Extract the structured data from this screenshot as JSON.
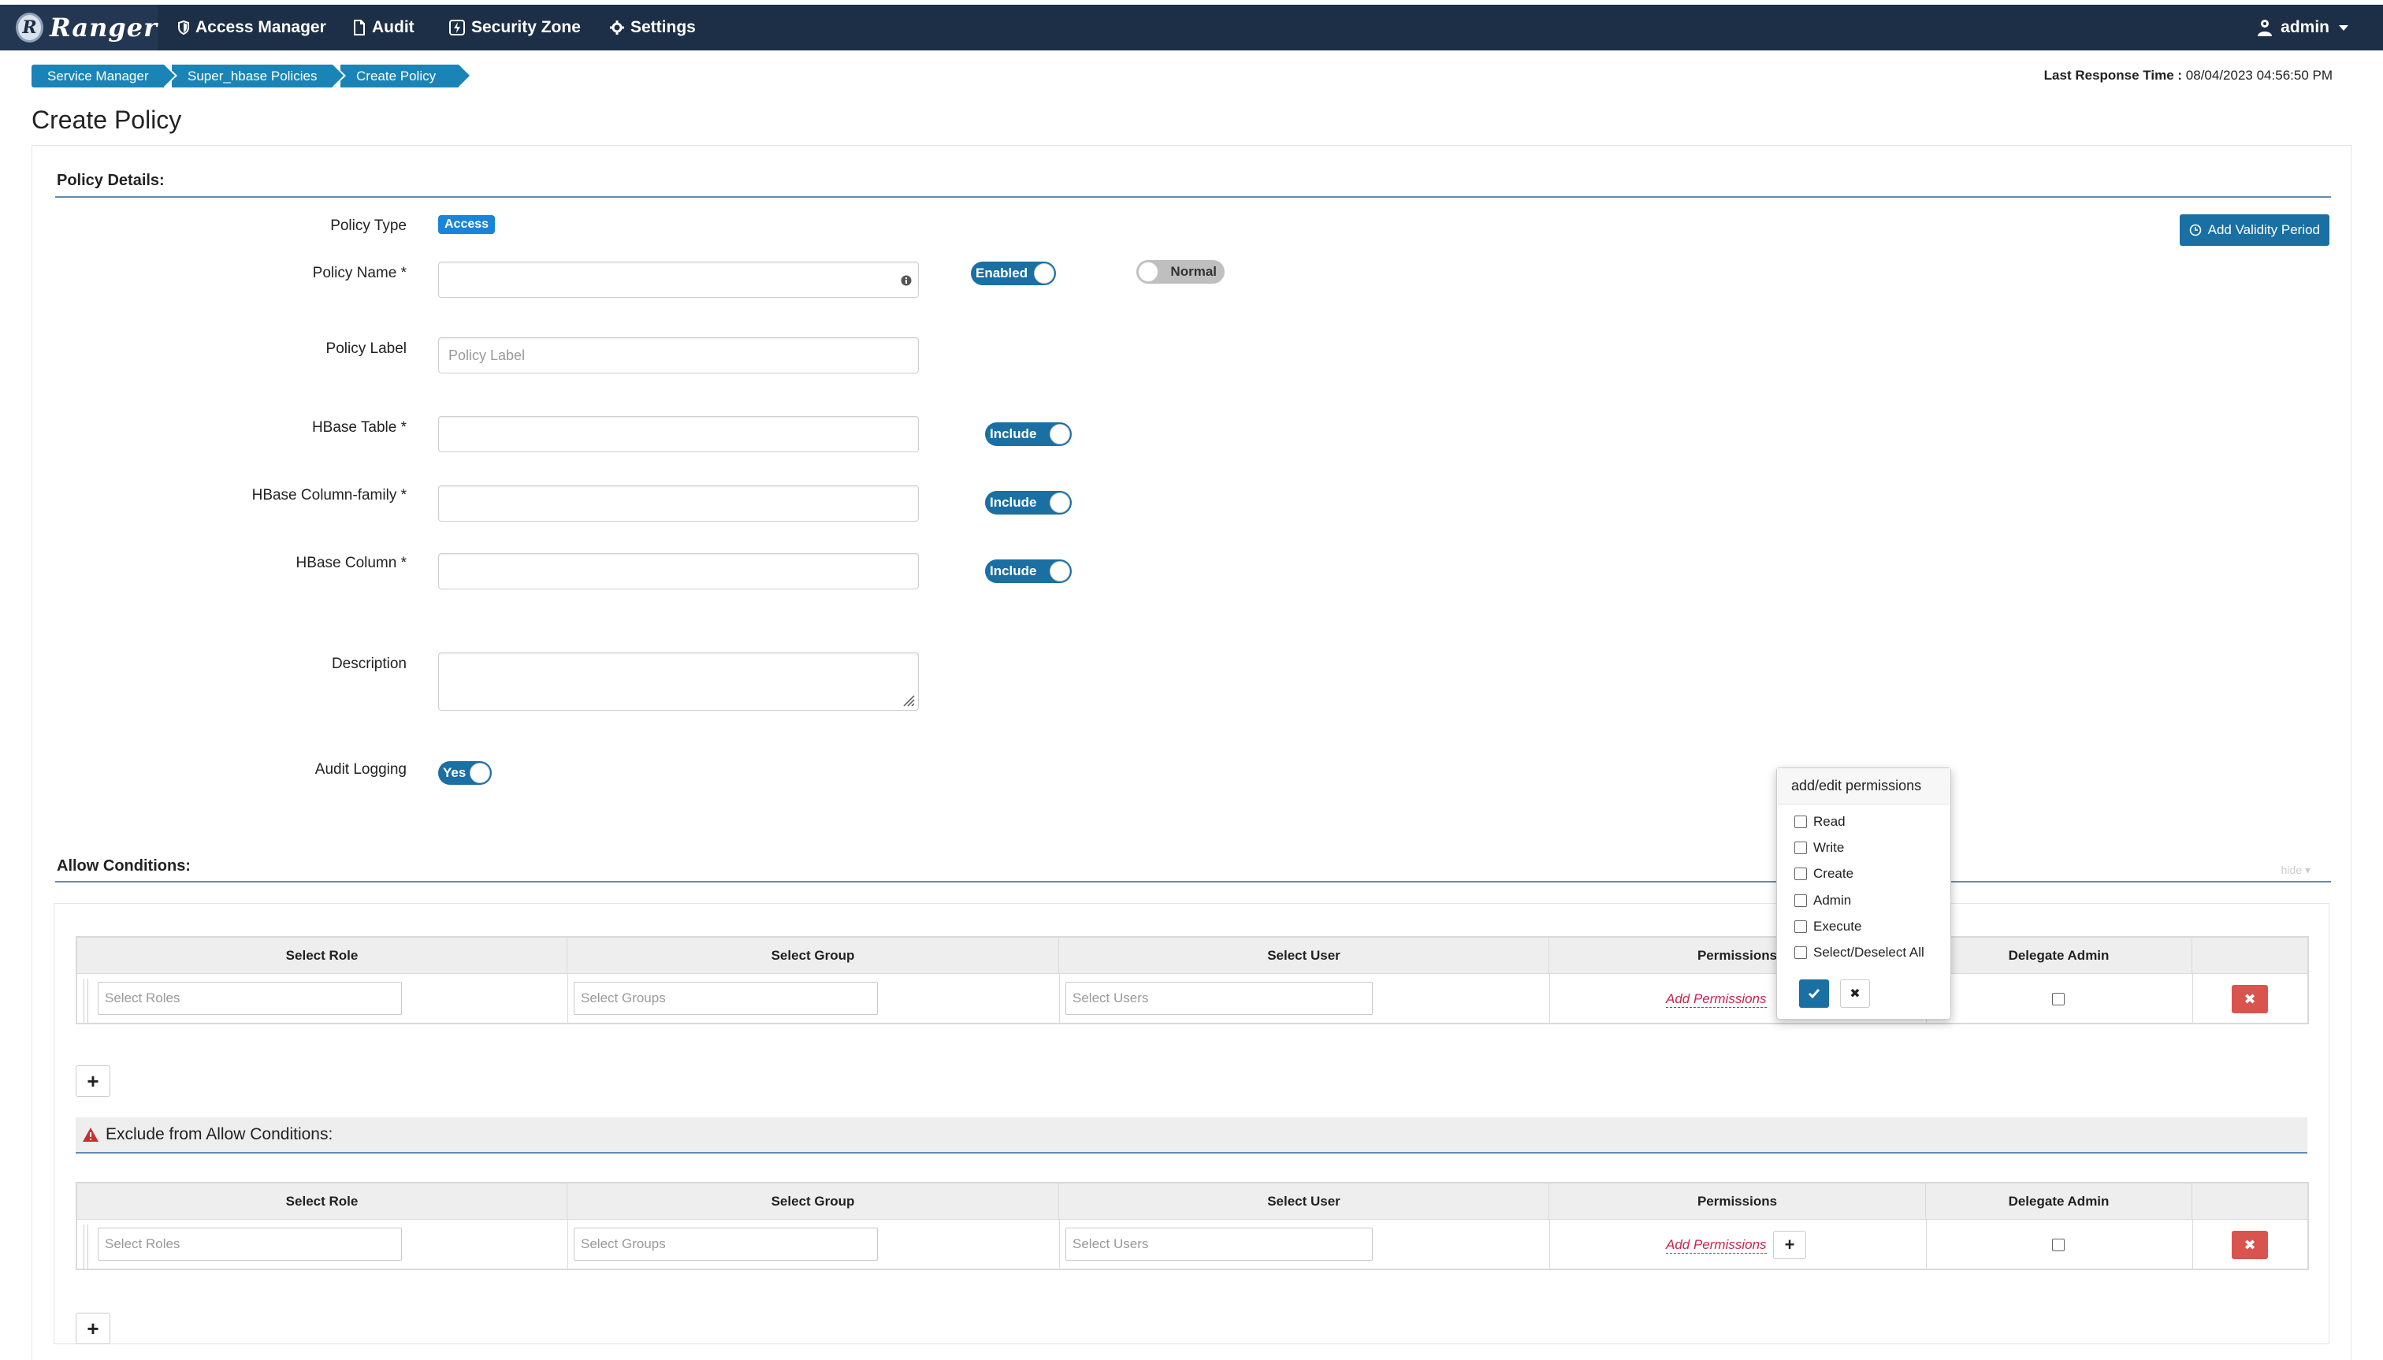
{
  "nav": {
    "brand": "Ranger",
    "items": [
      "Access Manager",
      "Audit",
      "Security Zone",
      "Settings"
    ],
    "user": "admin"
  },
  "breadcrumb": [
    "Service Manager",
    "Super_hbase Policies",
    "Create Policy"
  ],
  "last_response": {
    "label": "Last Response Time :",
    "value": "08/04/2023 04:56:50 PM"
  },
  "page_title": "Create Policy",
  "policy_details": {
    "heading": "Policy Details:",
    "policy_type_label": "Policy Type",
    "policy_type_value": "Access",
    "policy_name_label": "Policy Name *",
    "enabled_toggle": "Enabled",
    "normal_toggle": "Normal",
    "policy_label_label": "Policy Label",
    "policy_label_placeholder": "Policy Label",
    "hbase_table_label": "HBase Table *",
    "hbase_cf_label": "HBase Column-family *",
    "hbase_column_label": "HBase Column *",
    "include_label": "Include",
    "description_label": "Description",
    "audit_logging_label": "Audit Logging",
    "audit_logging_value": "Yes",
    "add_validity_button": "Add Validity Period"
  },
  "allow_conditions": {
    "heading": "Allow Conditions:",
    "hide_link": "hide",
    "columns": [
      "Select Role",
      "Select Group",
      "Select User",
      "Permissions",
      "Delegate Admin"
    ],
    "row": {
      "roles_placeholder": "Select Roles",
      "groups_placeholder": "Select Groups",
      "users_placeholder": "Select Users",
      "add_permissions": "Add Permissions"
    }
  },
  "exclude_allow": {
    "heading": "Exclude from Allow Conditions:",
    "columns": [
      "Select Role",
      "Select Group",
      "Select User",
      "Permissions",
      "Delegate Admin"
    ],
    "row": {
      "roles_placeholder": "Select Roles",
      "groups_placeholder": "Select Groups",
      "users_placeholder": "Select Users",
      "add_permissions": "Add Permissions"
    }
  },
  "popover": {
    "title": "add/edit permissions",
    "options": [
      "Read",
      "Write",
      "Create",
      "Admin",
      "Execute",
      "Select/Deselect All"
    ]
  },
  "colors": {
    "navbar": "#1d2f46",
    "accent": "#1a6fa3",
    "breadcrumb": "#1a84b6",
    "danger": "#d9534f",
    "link": "#c7254e"
  }
}
